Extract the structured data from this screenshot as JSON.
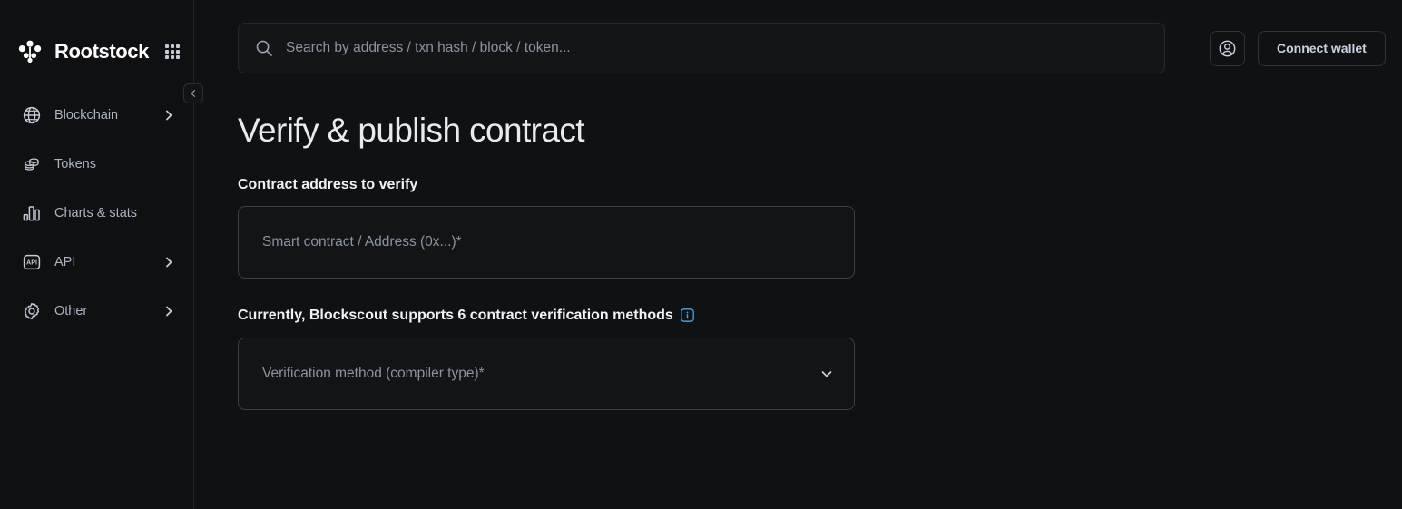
{
  "brand": {
    "name": "Rootstock",
    "logo_icon": "rootstock-cluster-icon",
    "apps_icon": "apps-grid-icon"
  },
  "sidebar": {
    "collapse_icon": "chevron-left-icon",
    "items": [
      {
        "label": "Blockchain",
        "icon": "globe-icon",
        "has_chevron": true
      },
      {
        "label": "Tokens",
        "icon": "coins-icon",
        "has_chevron": false
      },
      {
        "label": "Charts & stats",
        "icon": "bar-chart-icon",
        "has_chevron": false
      },
      {
        "label": "API",
        "icon": "api-icon",
        "has_chevron": true
      },
      {
        "label": "Other",
        "icon": "gear-icon",
        "has_chevron": true
      }
    ]
  },
  "topbar": {
    "search": {
      "placeholder": "Search by address / txn hash / block / token...",
      "value": "",
      "icon": "search-icon"
    },
    "profile_icon": "user-circle-icon",
    "connect_wallet_label": "Connect wallet"
  },
  "main": {
    "title": "Verify & publish contract",
    "address_section": {
      "label": "Contract address to verify",
      "input_placeholder": "Smart contract / Address (0x...)*",
      "input_value": ""
    },
    "methods_section": {
      "text": "Currently, Blockscout supports 6 contract verification methods",
      "info_icon": "info-icon",
      "select_placeholder": "Verification method (compiler type)*",
      "select_value": "",
      "chevron_icon": "chevron-down-icon"
    }
  },
  "colors": {
    "page_bg": "#101112",
    "sidebar_bg": "#0f1011",
    "border": "#39404e",
    "accent_info": "#4da2e8",
    "text_primary": "#e8eaee",
    "text_muted": "#8a93a3"
  }
}
